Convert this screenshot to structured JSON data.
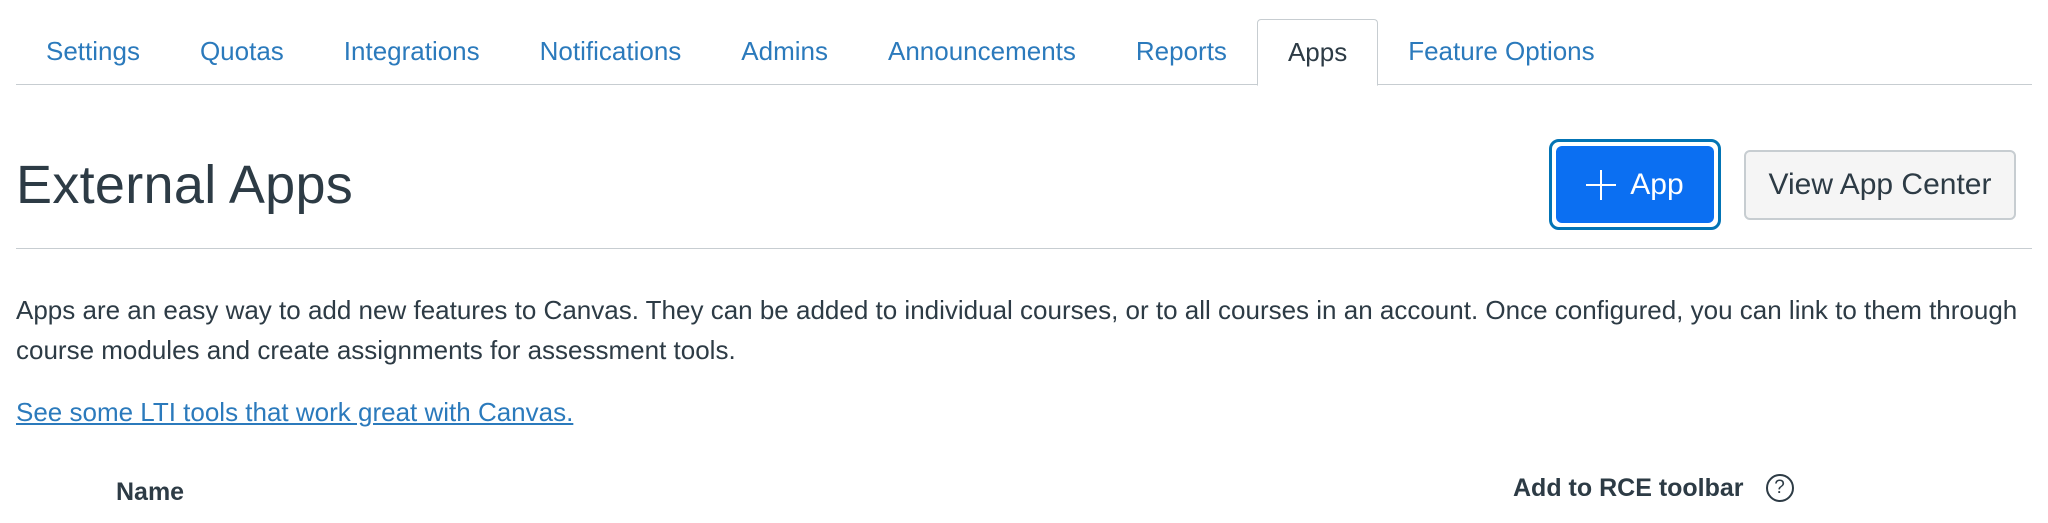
{
  "tabs": [
    {
      "label": "Settings",
      "active": false
    },
    {
      "label": "Quotas",
      "active": false
    },
    {
      "label": "Integrations",
      "active": false
    },
    {
      "label": "Notifications",
      "active": false
    },
    {
      "label": "Admins",
      "active": false
    },
    {
      "label": "Announcements",
      "active": false
    },
    {
      "label": "Reports",
      "active": false
    },
    {
      "label": "Apps",
      "active": true
    },
    {
      "label": "Feature Options",
      "active": false
    }
  ],
  "header": {
    "title": "External Apps",
    "add_app_label": "App",
    "view_app_center_label": "View App Center",
    "add_app_icon": "plus-icon"
  },
  "description": "Apps are an easy way to add new features to Canvas. They can be added to individual courses, or to all courses in an account. Once configured, you can link to them through course modules and create assignments for assessment tools.",
  "lti_link": "See some LTI tools that work great with Canvas.",
  "table": {
    "columns": {
      "name": "Name",
      "rce_toolbar": "Add to RCE toolbar",
      "help_icon_glyph": "?"
    }
  },
  "colors": {
    "link": "#2b7abc",
    "text": "#2d3b45",
    "primary_button": "#0b6ff2",
    "focus_ring": "#0374b5"
  }
}
